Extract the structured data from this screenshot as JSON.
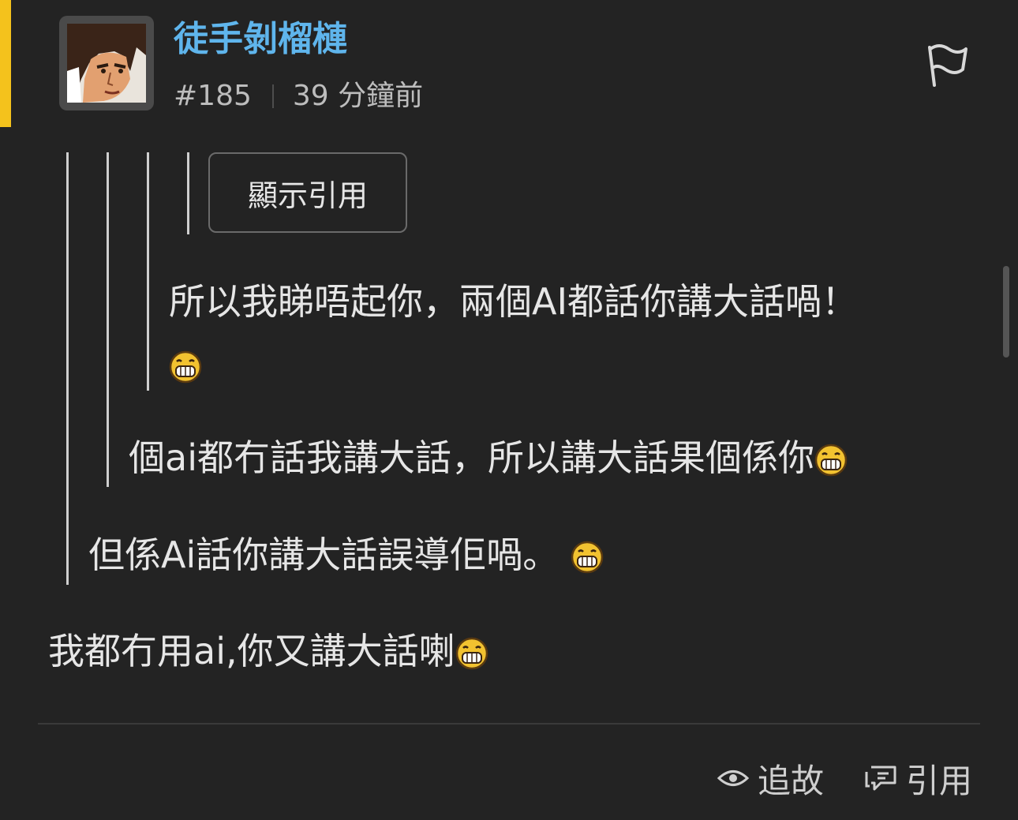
{
  "post": {
    "author": "徒手剝榴槤",
    "post_number": "#185",
    "time": "39 分鐘前",
    "flag_icon": "flag-icon"
  },
  "quote": {
    "show_quote_label": "顯示引用",
    "level3_text_line1": "所以我睇唔起你，兩個AI都話你講大話喎！",
    "level2_text": "個ai都冇話我講大話，所以講大話果個係你",
    "level1_text": "但係Ai話你講大話誤導佢喎。"
  },
  "reply": {
    "text": "我都冇用ai,你又講大話喇"
  },
  "actions": {
    "follow_label": "追故",
    "follow_icon": "eye-icon",
    "quote_label": "引用",
    "quote_icon": "quote-bubble-icon"
  },
  "emoji_icon": "grin-emoji-icon",
  "colors": {
    "background": "#232323",
    "username": "#5fb5ec",
    "accent_bar": "#f4c21c",
    "text": "#e6e6e6",
    "muted": "#bdbdbd"
  }
}
